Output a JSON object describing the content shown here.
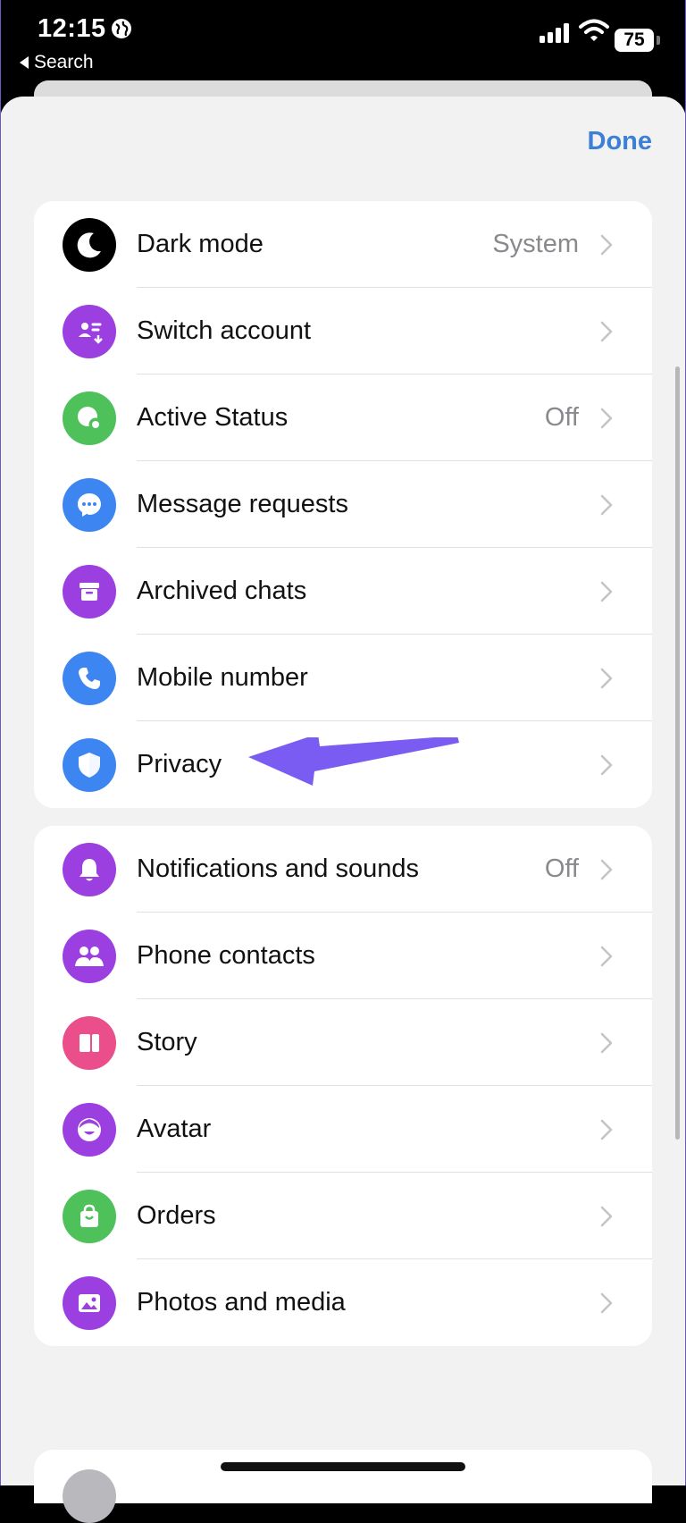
{
  "status_bar": {
    "time": "12:15",
    "back_label": "Search",
    "battery": "75"
  },
  "header": {
    "done_label": "Done"
  },
  "section1": [
    {
      "label": "Dark mode",
      "value": "System",
      "icon": "moon-icon",
      "color": "#000000"
    },
    {
      "label": "Switch account",
      "value": "",
      "icon": "switch-account-icon",
      "color": "#9b3fe0"
    },
    {
      "label": "Active Status",
      "value": "Off",
      "icon": "active-status-icon",
      "color": "#4ec15a"
    },
    {
      "label": "Message requests",
      "value": "",
      "icon": "message-bubble-icon",
      "color": "#3d86f2"
    },
    {
      "label": "Archived chats",
      "value": "",
      "icon": "archive-box-icon",
      "color": "#9b3fe0"
    },
    {
      "label": "Mobile number",
      "value": "",
      "icon": "phone-icon",
      "color": "#3d86f2"
    },
    {
      "label": "Privacy",
      "value": "",
      "icon": "shield-icon",
      "color": "#3d86f2"
    }
  ],
  "section2": [
    {
      "label": "Notifications and sounds",
      "value": "Off",
      "icon": "bell-icon",
      "color": "#9b3fe0"
    },
    {
      "label": "Phone contacts",
      "value": "",
      "icon": "people-icon",
      "color": "#9b3fe0"
    },
    {
      "label": "Story",
      "value": "",
      "icon": "story-icon",
      "color": "#ea4f8b"
    },
    {
      "label": "Avatar",
      "value": "",
      "icon": "avatar-face-icon",
      "color": "#9b3fe0"
    },
    {
      "label": "Orders",
      "value": "",
      "icon": "shopping-bag-icon",
      "color": "#4ec15a"
    },
    {
      "label": "Photos and media",
      "value": "",
      "icon": "photo-icon",
      "color": "#9b3fe0"
    }
  ],
  "annotation": {
    "arrow_color": "#7b5cf2"
  }
}
